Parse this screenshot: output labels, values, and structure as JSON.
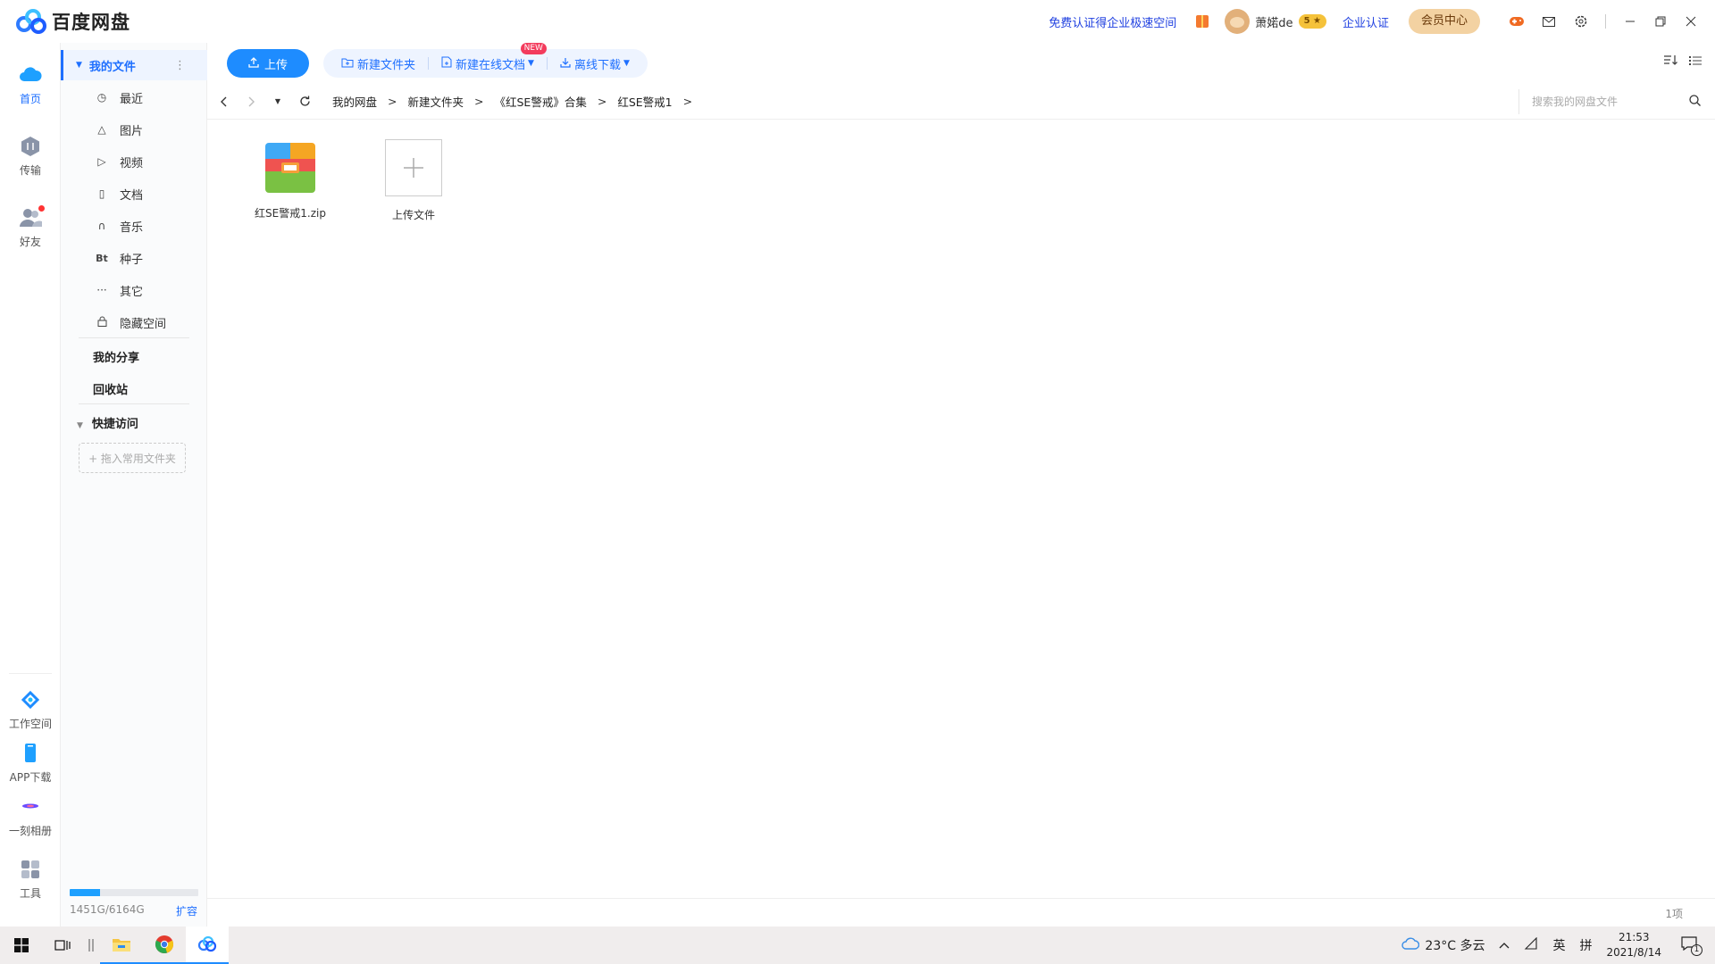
{
  "app": {
    "title": "百度网盘"
  },
  "titlebar": {
    "promo": "免费认证得企业极速空间",
    "username": "萧婼de",
    "level": "5 ★",
    "enterprise_cert": "企业认证",
    "vip_center": "会员中心",
    "icons": [
      "gift-icon",
      "game-icon",
      "mail-icon",
      "settings-icon"
    ],
    "window_controls": [
      "minimize",
      "restore",
      "close"
    ]
  },
  "rail": {
    "items": [
      {
        "label": "首页",
        "icon": "cloud-icon",
        "active": true
      },
      {
        "label": "传输",
        "icon": "transfer-icon",
        "active": false
      },
      {
        "label": "好友",
        "icon": "friends-icon",
        "active": false,
        "has_dot": true
      }
    ],
    "bottom_items": [
      {
        "label": "工作空间",
        "icon": "workspace-icon"
      },
      {
        "label": "APP下载",
        "icon": "phone-icon"
      },
      {
        "label": "一刻相册",
        "icon": "album-icon"
      },
      {
        "label": "工具",
        "icon": "tools-icon"
      }
    ]
  },
  "sidebar": {
    "header": "我的文件",
    "categories": [
      {
        "label": "最近",
        "icon": "clock-icon"
      },
      {
        "label": "图片",
        "icon": "image-icon"
      },
      {
        "label": "视频",
        "icon": "play-icon"
      },
      {
        "label": "文档",
        "icon": "document-icon"
      },
      {
        "label": "音乐",
        "icon": "headphone-icon"
      },
      {
        "label": "种子",
        "icon": "bt-icon"
      },
      {
        "label": "其它",
        "icon": "more-icon"
      },
      {
        "label": "隐藏空间",
        "icon": "lock-icon"
      }
    ],
    "my_share": "我的分享",
    "recycle": "回收站",
    "quick_access": "快捷访问",
    "drop_hint": "+ 拖入常用文件夹",
    "storage": {
      "text": "1451G/6164G",
      "used_fraction": 0.235,
      "expand": "扩容"
    }
  },
  "toolbar": {
    "upload": "上传",
    "new_folder": "新建文件夹",
    "new_online_doc": "新建在线文档",
    "new_badge": "NEW",
    "offline_download": "离线下载"
  },
  "navbar": {
    "breadcrumbs": [
      "我的网盘",
      "新建文件夹",
      "《红SE警戒》合集",
      "红SE警戒1"
    ],
    "search_placeholder": "搜索我的网盘文件"
  },
  "files": [
    {
      "name": "红SE警戒1.zip",
      "type": "zip"
    },
    {
      "name": "上传文件",
      "type": "upload"
    }
  ],
  "footer": {
    "count": "1项"
  },
  "taskbar": {
    "weather": "23°C 多云",
    "ime_lang": "英",
    "ime_mode": "拼",
    "time": "21:53",
    "date": "2021/8/14",
    "notifications": "1"
  }
}
